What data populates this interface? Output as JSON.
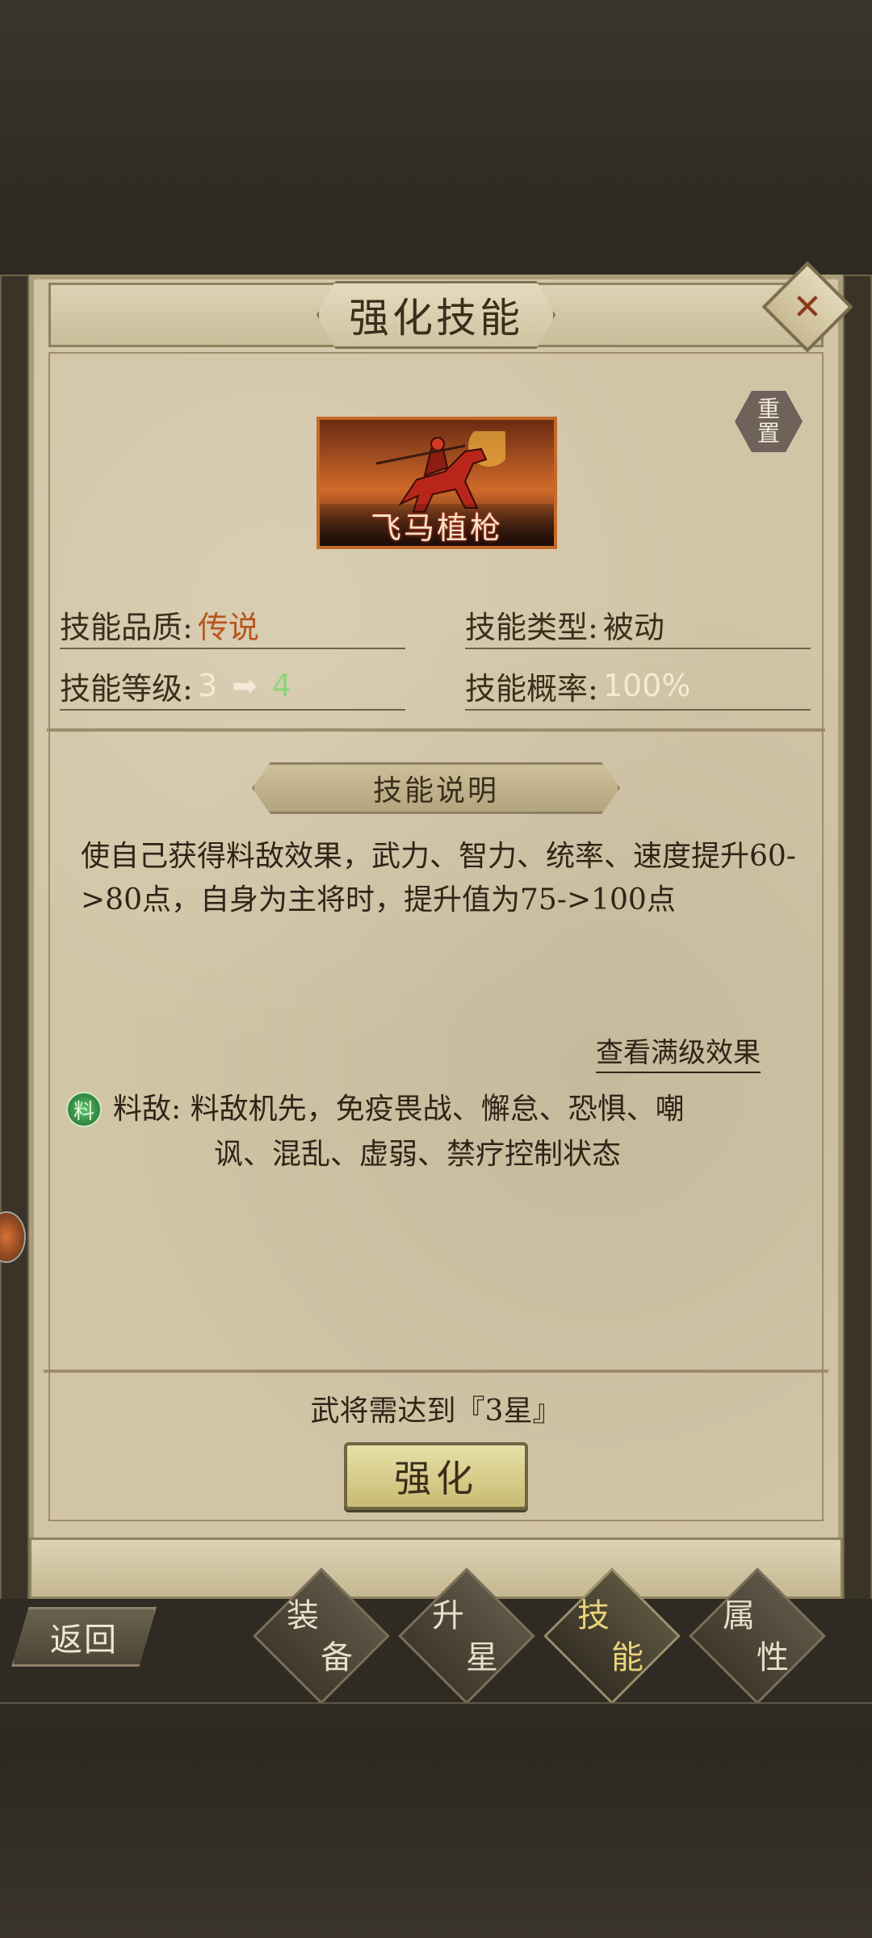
{
  "dialog": {
    "title": "强化技能",
    "close_label": "✕",
    "reset_label_1": "重",
    "reset_label_2": "置"
  },
  "skill": {
    "name": "飞马植枪",
    "quality_label": "技能品质:",
    "quality_value": "传说",
    "type_label": "技能类型:",
    "type_value": "被动",
    "level_label": "技能等级:",
    "level_from": "3",
    "level_to": "4",
    "chance_label": "技能概率:",
    "chance_value": "100%"
  },
  "description": {
    "section_title": "技能说明",
    "text": "使自己获得料敌效果，武力、智力、统率、速度提升60->80点，自身为主将时，提升值为75->100点",
    "max_level_link": "查看满级效果"
  },
  "effect": {
    "badge": "料",
    "label": "料敌:",
    "text_line1": "料敌机先，免疫畏战、懈怠、恐惧、嘲",
    "text_line2": "讽、混乱、虚弱、禁疗控制状态"
  },
  "action": {
    "requirement": "武将需达到『3星』",
    "button_label": "强化"
  },
  "nav": {
    "back_label": "返回",
    "tabs": [
      {
        "c1": "装",
        "c2": "备"
      },
      {
        "c1": "升",
        "c2": "星"
      },
      {
        "c1": "技",
        "c2": "能"
      },
      {
        "c1": "属",
        "c2": "性"
      }
    ],
    "active_tab": "技能"
  },
  "colors": {
    "quality": "#b8561e",
    "level_to": "#8fd47a",
    "button": "#c8bb72"
  }
}
